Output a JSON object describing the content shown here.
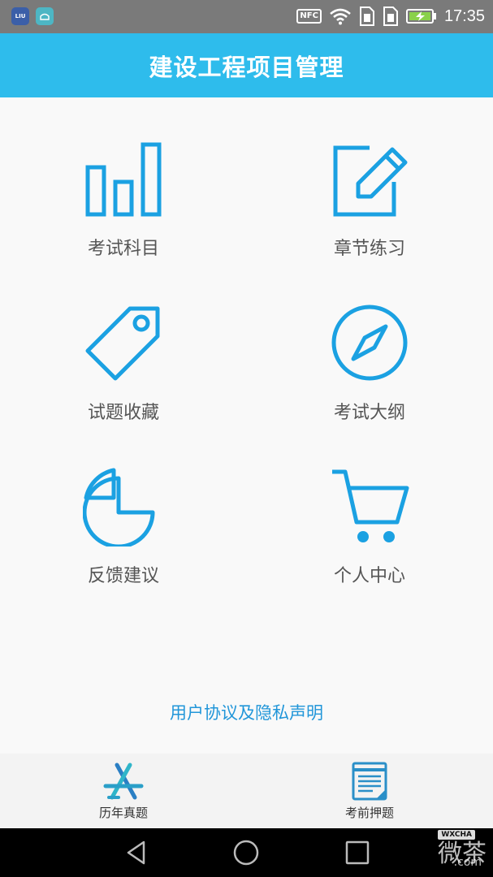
{
  "status_bar": {
    "nfc_label": "NFC",
    "time": "17:35",
    "icons": [
      "app-icon-1",
      "app-icon-2",
      "nfc-icon",
      "wifi-icon",
      "sim1-icon",
      "sim2-icon",
      "battery-charging-icon"
    ]
  },
  "header": {
    "title": "建设工程项目管理"
  },
  "grid": {
    "items": [
      {
        "label": "考试科目",
        "icon": "bar-chart-icon"
      },
      {
        "label": "章节练习",
        "icon": "edit-icon"
      },
      {
        "label": "试题收藏",
        "icon": "tag-icon"
      },
      {
        "label": "考试大纲",
        "icon": "compass-icon"
      },
      {
        "label": "反馈建议",
        "icon": "pie-chart-icon"
      },
      {
        "label": "个人中心",
        "icon": "cart-icon"
      }
    ]
  },
  "footer": {
    "agreement_link": "用户协议及隐私声明"
  },
  "tabs": [
    {
      "label": "历年真题",
      "icon": "app-store-icon"
    },
    {
      "label": "考前押题",
      "icon": "notepad-icon"
    }
  ],
  "watermark": {
    "text": "微茶",
    "badge": "WXCHA",
    "suffix": ".com"
  },
  "colors": {
    "accent": "#2ebcec",
    "icon_blue": "#1ba1e2",
    "link": "#2196d9",
    "status_bar": "#7a7a7a"
  }
}
